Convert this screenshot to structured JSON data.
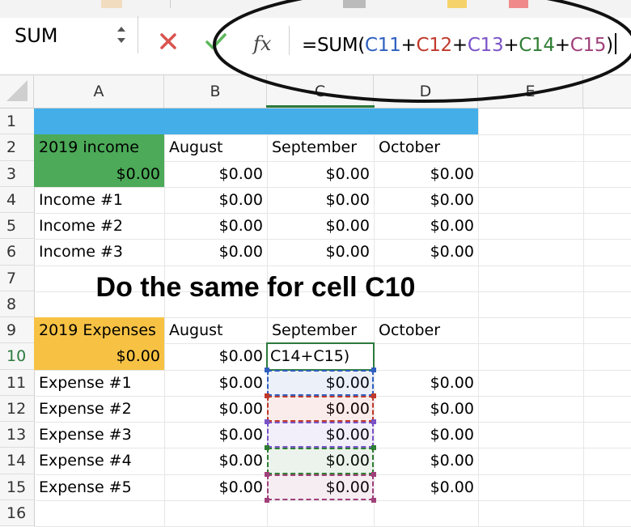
{
  "formula_bar": {
    "name_box": "SUM",
    "fx_label": "fx",
    "formula": [
      {
        "text": "=SUM(",
        "color": "#000000"
      },
      {
        "text": "C11",
        "color": "#2f5fbf"
      },
      {
        "text": "+",
        "color": "#000000"
      },
      {
        "text": "C12",
        "color": "#c0392b"
      },
      {
        "text": "+",
        "color": "#000000"
      },
      {
        "text": "C13",
        "color": "#7a52c7"
      },
      {
        "text": "+",
        "color": "#000000"
      },
      {
        "text": "C14",
        "color": "#2e7d32"
      },
      {
        "text": "+",
        "color": "#000000"
      },
      {
        "text": "C15",
        "color": "#a0407a"
      },
      {
        "text": ")",
        "color": "#000000"
      }
    ]
  },
  "columns": [
    "A",
    "B",
    "C",
    "D",
    "E"
  ],
  "rows": [
    "1",
    "2",
    "3",
    "4",
    "5",
    "6",
    "7",
    "8",
    "9",
    "10",
    "11",
    "12",
    "13",
    "14",
    "15",
    "16"
  ],
  "selected_row": "10",
  "colors": {
    "banner_blue": "#44aee9",
    "income_green": "#4caa58",
    "expenses_yellow": "#f7c244",
    "ref_blue": "#2f5fbf",
    "ref_red": "#c0392b",
    "ref_purple": "#7a52c7",
    "ref_green": "#2e7d32",
    "ref_magenta": "#a0407a",
    "active_green": "#2c7a3e"
  },
  "income": {
    "header": [
      "2019 income",
      "August",
      "September",
      "October"
    ],
    "totals": [
      "$0.00",
      "$0.00",
      "$0.00",
      "$0.00"
    ],
    "lines": [
      [
        "Income #1",
        "$0.00",
        "$0.00",
        "$0.00"
      ],
      [
        "Income #2",
        "$0.00",
        "$0.00",
        "$0.00"
      ],
      [
        "Income #3",
        "$0.00",
        "$0.00",
        "$0.00"
      ]
    ]
  },
  "annotation": "Do the same for cell C10",
  "expenses": {
    "header": [
      "2019 Expenses",
      "August",
      "September",
      "October"
    ],
    "totals": [
      "$0.00",
      "$0.00",
      "C14+C15)",
      ""
    ],
    "lines": [
      [
        "Expense #1",
        "$0.00",
        "$0.00",
        "$0.00"
      ],
      [
        "Expense #2",
        "$0.00",
        "$0.00",
        "$0.00"
      ],
      [
        "Expense #3",
        "$0.00",
        "$0.00",
        "$0.00"
      ],
      [
        "Expense #4",
        "$0.00",
        "$0.00",
        "$0.00"
      ],
      [
        "Expense #5",
        "$0.00",
        "$0.00",
        "$0.00"
      ]
    ]
  }
}
